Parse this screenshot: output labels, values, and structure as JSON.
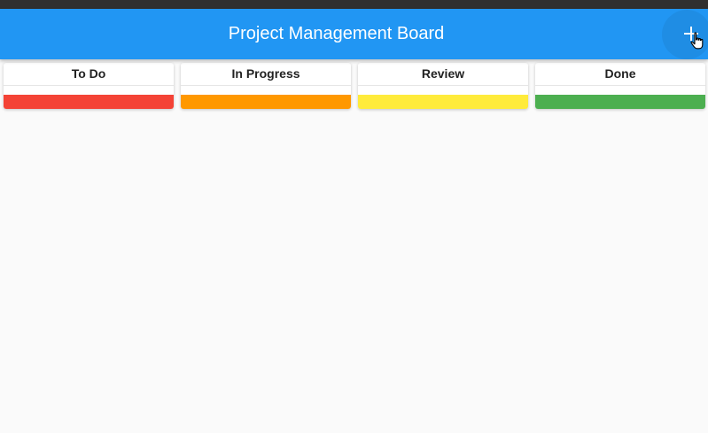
{
  "app_bar": {
    "title": "Project Management Board",
    "add_icon": "plus-icon"
  },
  "columns": [
    {
      "label": "To Do",
      "color": "#f44336"
    },
    {
      "label": "In Progress",
      "color": "#ff9800"
    },
    {
      "label": "Review",
      "color": "#ffeb3b"
    },
    {
      "label": "Done",
      "color": "#4caf50"
    }
  ]
}
